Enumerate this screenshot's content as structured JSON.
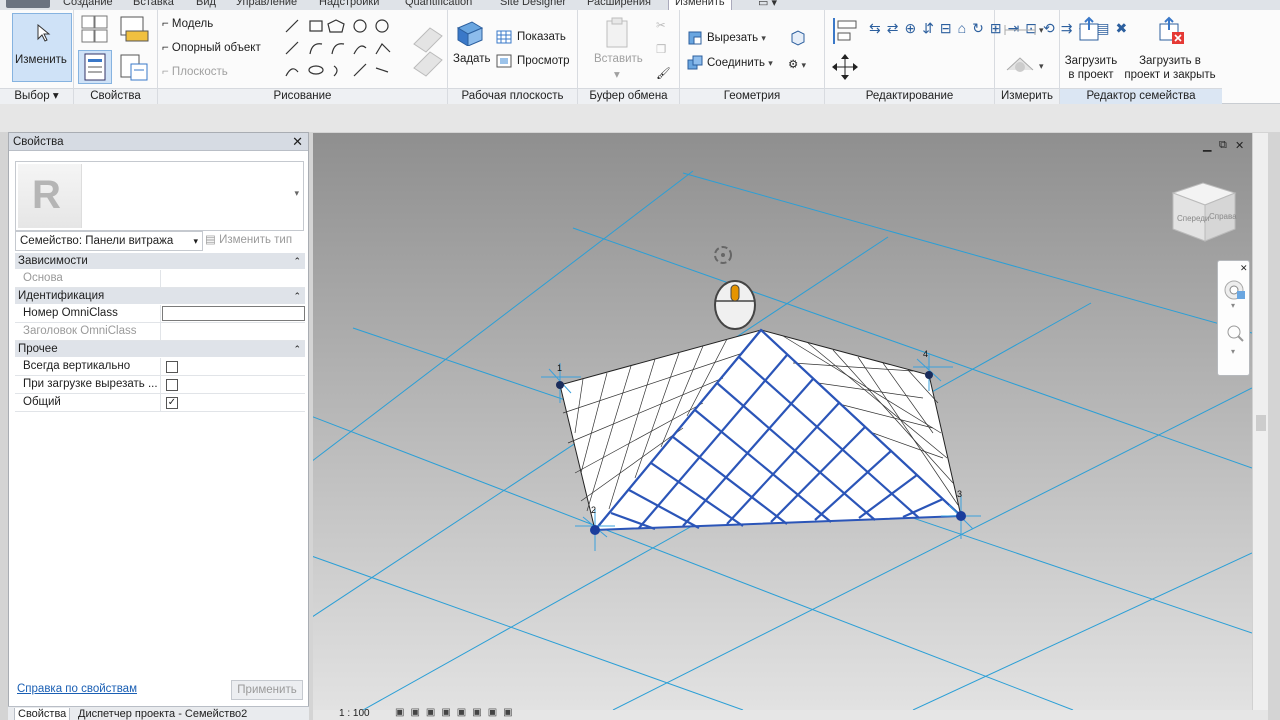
{
  "ribbon_tabs": [
    "Создание",
    "Вставка",
    "Вид",
    "Управление",
    "Надстройки",
    "Quantification",
    "Site Designer",
    "Расширения",
    "Изменить"
  ],
  "active_tab": "Изменить",
  "ribbon": {
    "modify_label": "Изменить",
    "select_panel": "Выбор",
    "properties_panel": "Свойства",
    "draw": {
      "title": "Рисование",
      "model": "Модель",
      "reference": "Опорный объект",
      "plane": "Плоскость"
    },
    "workplane": {
      "title": "Рабочая плоскость",
      "set": "Задать",
      "show": "Показать",
      "viewer": "Просмотр"
    },
    "clipboard": {
      "title": "Буфер обмена",
      "paste": "Вставить"
    },
    "geometry": {
      "title": "Геометрия",
      "cut": "Вырезать",
      "join": "Соединить"
    },
    "edit_panel": "Редактирование",
    "measure_panel": "Измерить",
    "family_editor": {
      "title": "Редактор семейства",
      "load": "Загрузить в проект",
      "load_close": "Загрузить в проект и закрыть"
    }
  },
  "properties": {
    "title": "Свойства",
    "family": "Семейство: Панели витража",
    "edit_type": "Изменить тип",
    "groups": [
      {
        "name": "Зависимости",
        "rows": [
          {
            "name": "Основа",
            "type": "dim"
          }
        ]
      },
      {
        "name": "Идентификация",
        "rows": [
          {
            "name": "Номер OmniClass",
            "type": "input"
          },
          {
            "name": "Заголовок OmniClass",
            "type": "dim"
          }
        ]
      },
      {
        "name": "Прочее",
        "rows": [
          {
            "name": "Всегда вертикально",
            "type": "check",
            "checked": false
          },
          {
            "name": "При загрузке вырезать ...",
            "type": "check",
            "checked": false
          },
          {
            "name": "Общий",
            "type": "check",
            "checked": true
          }
        ]
      }
    ],
    "help_link": "Справка по свойствам",
    "apply": "Применить",
    "bottom_tabs": [
      "Свойства",
      "Диспетчер проекта - Семейство2"
    ]
  },
  "viewport": {
    "point_labels": [
      "1",
      "2",
      "3",
      "4"
    ],
    "viewcube_labels": [
      "Спереди",
      "Справа"
    ],
    "scale": "1 : 100"
  },
  "colors": {
    "accent": "#3a78c8",
    "grid_line": "#2b9fd6",
    "mesh_line": "#2b55b8"
  }
}
